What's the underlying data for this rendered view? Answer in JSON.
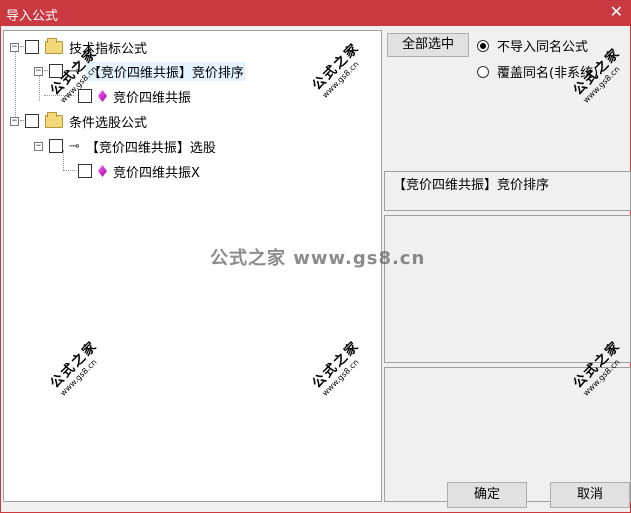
{
  "window": {
    "title": "导入公式",
    "close_glyph": "✕"
  },
  "tree": {
    "root1_label": "技术指标公式",
    "child1_label": "【竞价四维共振】竞价排序",
    "leaf1_label": "竞价四维共振",
    "root2_label": "条件选股公式",
    "child2_label": "【竞价四维共振】选股",
    "leaf2_label": "竞价四维共振X"
  },
  "right": {
    "select_all": "全部选中",
    "radio_no_import": "不导入同名公式",
    "radio_overwrite": "覆盖同名(非系统)",
    "selected_formula": "【竞价四维共振】竞价排序"
  },
  "buttons": {
    "ok": "确定",
    "cancel": "取消"
  },
  "watermark": {
    "center": "公式之家 www.gs8.cn",
    "stamp_cn": "公式之家",
    "stamp_url": "www.gs8.cn"
  },
  "colors": {
    "titlebar": "#c9393f",
    "title_text": "#ffffff"
  },
  "icons": [
    "close-icon",
    "folder-icon",
    "key-icon",
    "gem-icon",
    "expander-icon",
    "checkbox"
  ]
}
